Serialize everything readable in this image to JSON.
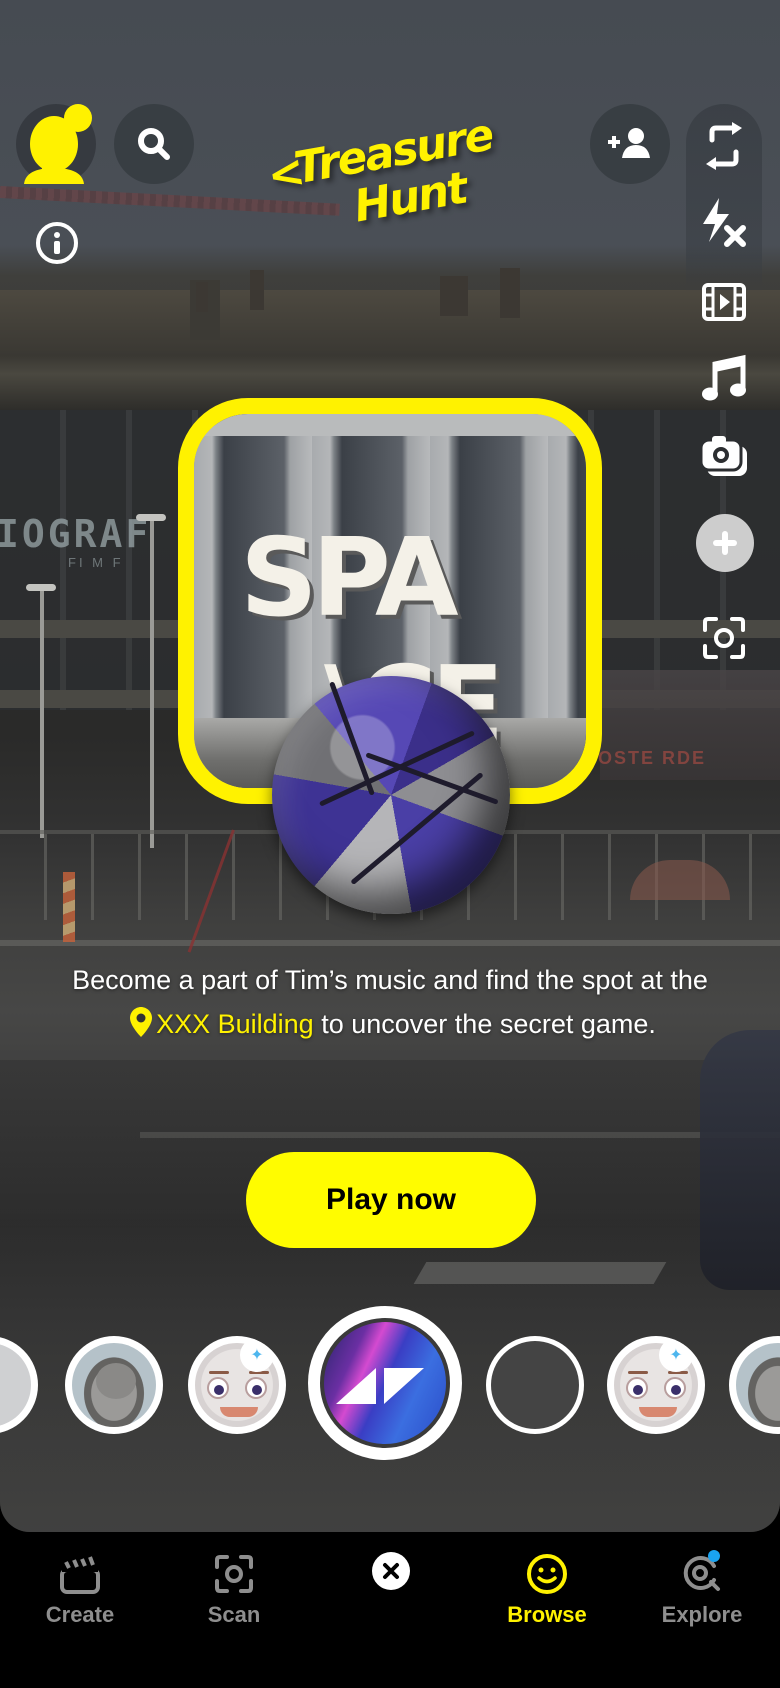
{
  "header": {
    "title_logo_line1": "Treasure",
    "title_logo_line2": "Hunt",
    "back_glyph": "<",
    "profile_icon": "bitmoji-avatar-icon",
    "search_icon": "search-icon",
    "info_icon": "info-icon",
    "add_friend_icon": "add-friend-icon"
  },
  "right_toolbar": [
    {
      "name": "flip-camera",
      "icon": "flip-camera-icon"
    },
    {
      "name": "flash-off",
      "icon": "flash-off-icon"
    },
    {
      "name": "video-mode",
      "icon": "film-icon"
    },
    {
      "name": "music",
      "icon": "music-note-icon"
    },
    {
      "name": "multi-capture",
      "icon": "camera-stack-icon"
    },
    {
      "name": "more",
      "icon": "plus-icon"
    },
    {
      "name": "scan",
      "icon": "scan-icon"
    }
  ],
  "scene": {
    "sign_line1": "SPA",
    "sign_line2": "\\CE",
    "bg_sign": "IOGRAF",
    "bg_sign_sub": "FI M F",
    "poster_text": "OSTE  RDE"
  },
  "description": {
    "part1": "Become a part of Tim’s music and find the spot at the",
    "location": "XXX Building",
    "part2": "to uncover the secret game."
  },
  "cta": {
    "play_label": "Play now"
  },
  "lens_carousel": [
    {
      "name": "donkey-lens",
      "kind": "photo"
    },
    {
      "name": "cat-lens",
      "kind": "photo"
    },
    {
      "name": "cartoon-face-lens",
      "kind": "face",
      "badge": "magic-wand-icon"
    },
    {
      "name": "treasure-hunt-lens",
      "kind": "active"
    },
    {
      "name": "empty-lens",
      "kind": "empty"
    },
    {
      "name": "cartoon-face-lens-2",
      "kind": "face",
      "badge": "magic-wand-icon"
    },
    {
      "name": "cat-lens-2",
      "kind": "photo"
    }
  ],
  "bottom_nav": {
    "items": [
      {
        "label": "Create",
        "icon": "clapperboard-icon",
        "active": false
      },
      {
        "label": "Scan",
        "icon": "scan-icon",
        "active": false
      },
      {
        "label": "Browse",
        "icon": "smiley-icon",
        "active": true
      },
      {
        "label": "Explore",
        "icon": "explore-search-icon",
        "active": false,
        "badge": true
      }
    ],
    "close_icon": "close-icon"
  },
  "colors": {
    "accent_yellow": "#fff200",
    "button_yellow": "#fffc00",
    "notification_blue": "#1aa3f0",
    "inactive_gray": "#8e8e8e"
  }
}
